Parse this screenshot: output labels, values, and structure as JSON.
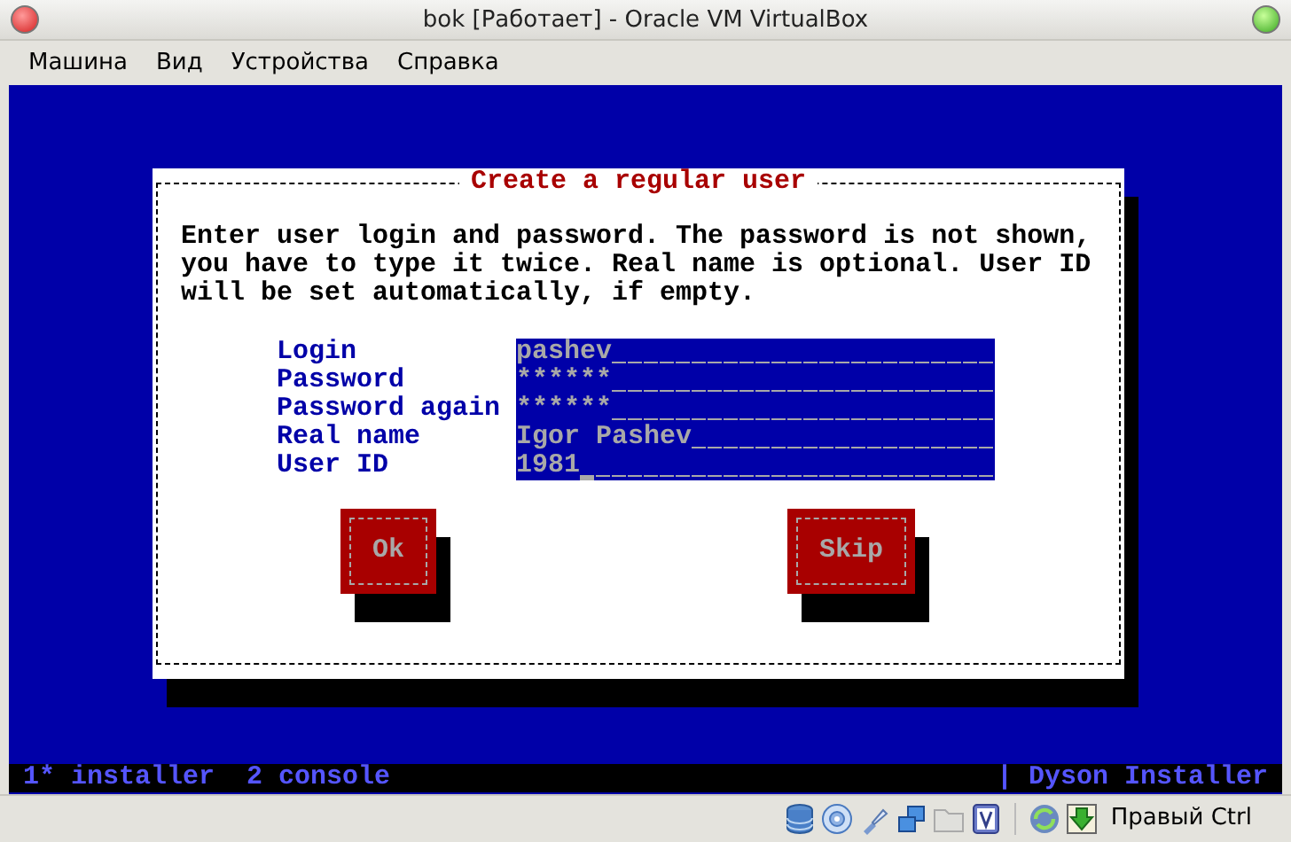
{
  "window": {
    "title": "bok [Работает] - Oracle VM VirtualBox"
  },
  "menu": [
    "Машина",
    "Вид",
    "Устройства",
    "Справка"
  ],
  "dialog": {
    "title": "Create a regular user",
    "text_lines": [
      "Enter user login and password. The password is not shown,",
      "you have to type it twice. Real name is optional. User ID",
      "will be set automatically, if empty."
    ],
    "fields": [
      {
        "label": "Login",
        "value": "pashev",
        "focused": false
      },
      {
        "label": "Password",
        "value": "******",
        "focused": false
      },
      {
        "label": "Password again",
        "value": "******",
        "focused": false
      },
      {
        "label": "Real name",
        "value": "Igor Pashev",
        "focused": false
      },
      {
        "label": "User ID",
        "value": "1981",
        "focused": true
      }
    ],
    "buttons": [
      {
        "label": "Ok"
      },
      {
        "label": "Skip"
      }
    ]
  },
  "console_bar": {
    "tabs": [
      "1* installer",
      "2 console"
    ],
    "right": "| Dyson Installer"
  },
  "status_bar": {
    "host_key": "Правый Ctrl"
  }
}
